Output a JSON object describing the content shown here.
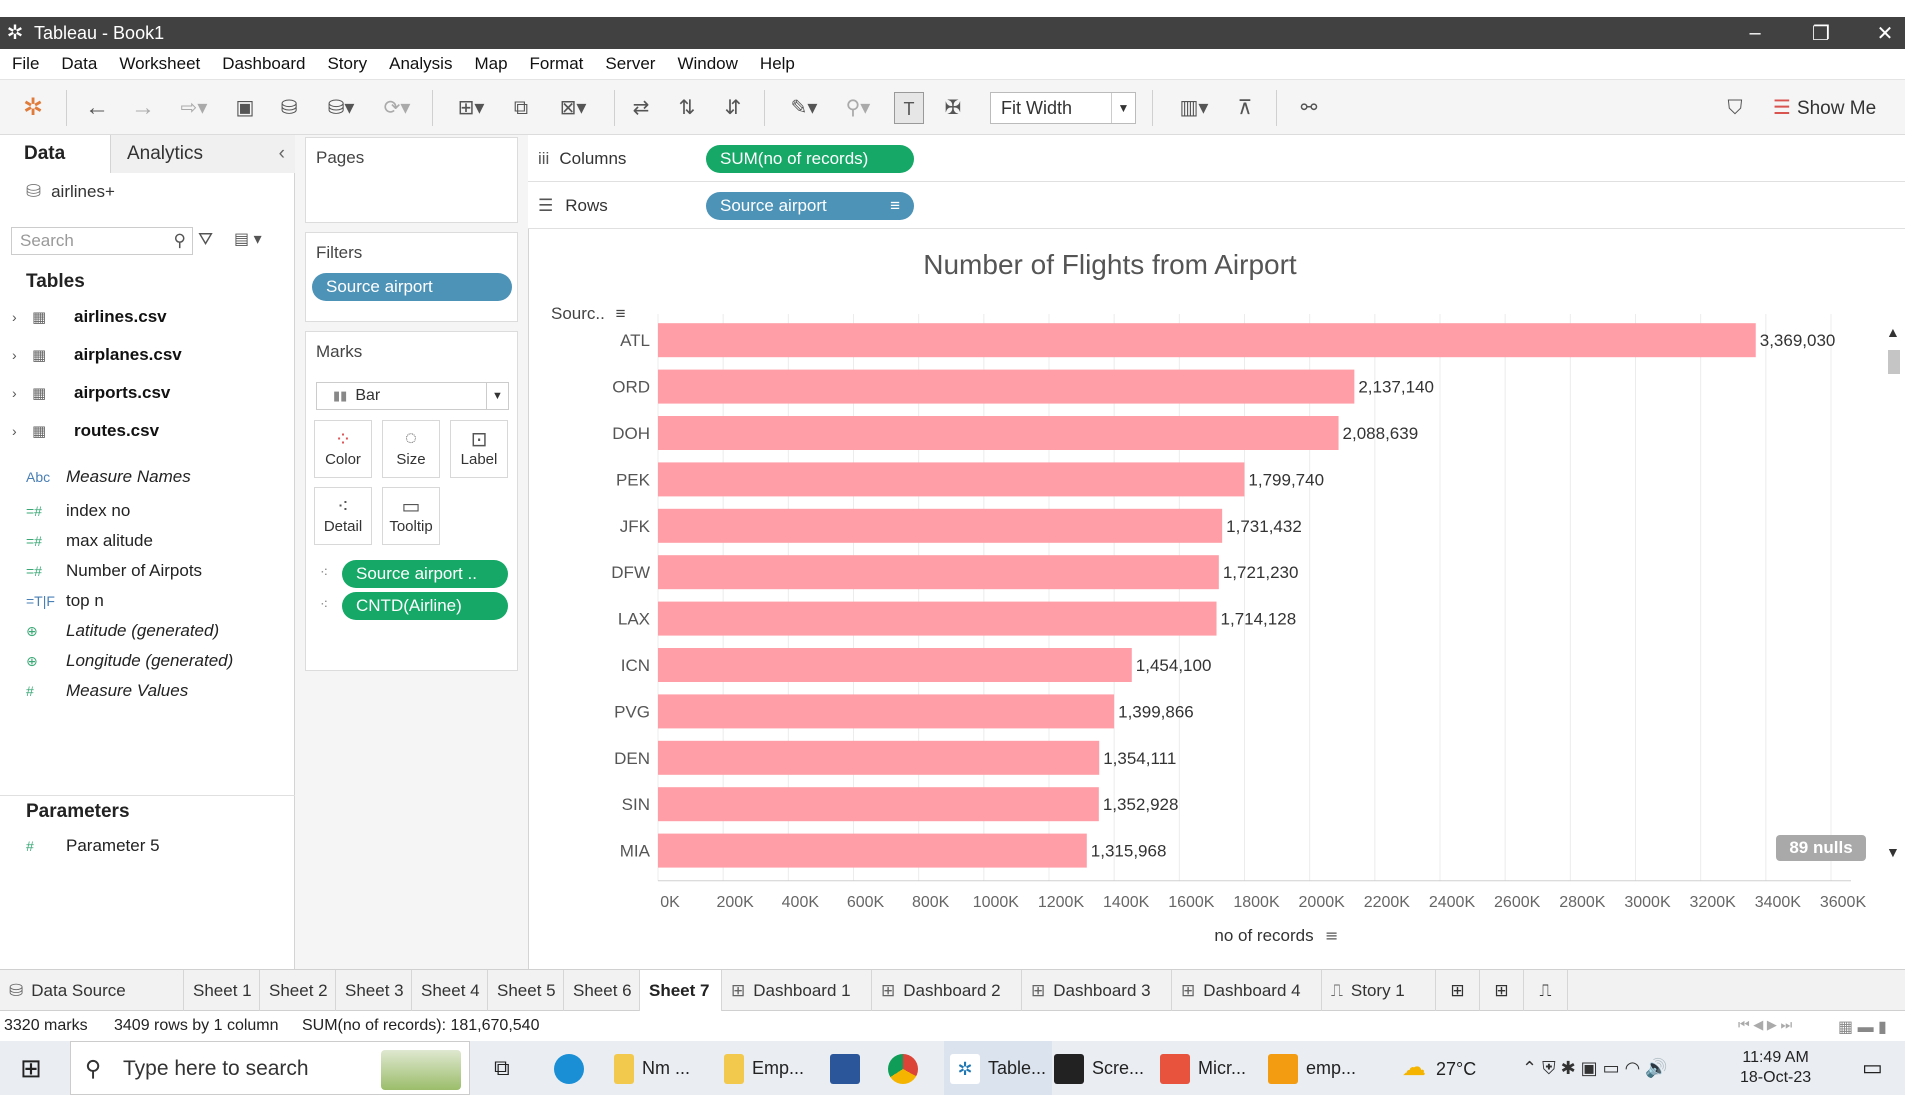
{
  "window": {
    "title": "Tableau - Book1"
  },
  "menu": [
    "File",
    "Data",
    "Worksheet",
    "Dashboard",
    "Story",
    "Analysis",
    "Map",
    "Format",
    "Server",
    "Window",
    "Help"
  ],
  "toolbar": {
    "fit": "Fit Width",
    "show_me": "Show Me"
  },
  "left_pane": {
    "tab_data": "Data",
    "tab_analytics": "Analytics",
    "datasource": "airlines+",
    "search_placeholder": "Search",
    "tables_title": "Tables",
    "tables": [
      "airlines.csv",
      "airplanes.csv",
      "airports.csv",
      "routes.csv"
    ],
    "fields": [
      {
        "icon": "Abc",
        "name": "Measure Names",
        "italic": true
      },
      {
        "icon": "=#",
        "name": "index no",
        "italic": false
      },
      {
        "icon": "=#",
        "name": "max alitude",
        "italic": false
      },
      {
        "icon": "=#",
        "name": "Number of Airpots",
        "italic": false
      },
      {
        "icon": "=T|F",
        "name": "top n",
        "italic": false
      },
      {
        "icon": "globe",
        "name": "Latitude (generated)",
        "italic": true
      },
      {
        "icon": "globe",
        "name": "Longitude (generated)",
        "italic": true
      },
      {
        "icon": "#",
        "name": "Measure Values",
        "italic": true
      }
    ],
    "parameters_title": "Parameters",
    "parameters": [
      "Parameter 5"
    ]
  },
  "shelves": {
    "pages": "Pages",
    "filters": "Filters",
    "filter_pill": "Source airport",
    "marks": "Marks",
    "mark_type": "Bar",
    "mark_buttons": [
      "Color",
      "Size",
      "Label",
      "Detail",
      "Tooltip"
    ],
    "mark_pills": [
      "Source airport ..",
      "CNTD(Airline)"
    ],
    "columns_label": "Columns",
    "columns_pill": "SUM(no of records)",
    "rows_label": "Rows",
    "rows_pill": "Source airport"
  },
  "chart_data": {
    "type": "bar",
    "orientation": "horizontal",
    "title": "Number of Flights from Airport",
    "category_header": "Sourc..",
    "xlabel": "no of records",
    "categories": [
      "ATL",
      "ORD",
      "DOH",
      "PEK",
      "JFK",
      "DFW",
      "LAX",
      "ICN",
      "PVG",
      "DEN",
      "SIN",
      "MIA"
    ],
    "values": [
      3369030,
      2137140,
      2088639,
      1799740,
      1731432,
      1721230,
      1714128,
      1454100,
      1399866,
      1354111,
      1352928,
      1315968
    ],
    "value_labels": [
      "3,369,030",
      "2,137,140",
      "2,088,639",
      "1,799,740",
      "1,731,432",
      "1,721,230",
      "1,714,128",
      "1,454,100",
      "1,399,866",
      "1,354,111",
      "1,352,928",
      "1,315,968"
    ],
    "xticks": [
      "0K",
      "200K",
      "400K",
      "600K",
      "800K",
      "1000K",
      "1200K",
      "1400K",
      "1600K",
      "1800K",
      "2000K",
      "2200K",
      "2400K",
      "2600K",
      "2800K",
      "3000K",
      "3200K",
      "3400K",
      "3600K"
    ],
    "xlim": [
      0,
      3600000
    ],
    "bar_color": "#ff9ea7",
    "nulls_badge": "89 nulls"
  },
  "sheet_tabs": [
    "Data Source",
    "Sheet 1",
    "Sheet 2",
    "Sheet 3",
    "Sheet 4",
    "Sheet 5",
    "Sheet 6",
    "Sheet 7",
    "Dashboard 1",
    "Dashboard 2",
    "Dashboard 3",
    "Dashboard 4",
    "Story 1"
  ],
  "active_sheet": "Sheet 7",
  "status": {
    "marks": "3320 marks",
    "rows": "3409 rows by 1 column",
    "sum": "SUM(no of records): 181,670,540"
  },
  "taskbar": {
    "search": "Type here to search",
    "apps": [
      "Nm ...",
      "Emp...",
      "Table...",
      "Scre...",
      "Micr...",
      "emp..."
    ],
    "weather": "27°C",
    "time": "11:49 AM",
    "date": "18-Oct-23"
  }
}
